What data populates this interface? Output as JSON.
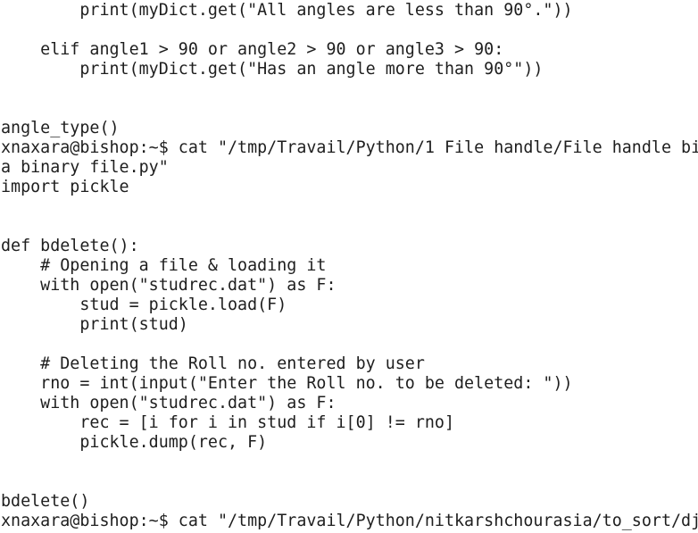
{
  "terminal": {
    "lines": [
      "        print(myDict.get(\"All angles are less than 90°.\"))",
      "",
      "    elif angle1 > 90 or angle2 > 90 or angle3 > 90:",
      "        print(myDict.get(\"Has an angle more than 90°\"))",
      "",
      "",
      "angle_type()",
      "xnaxara@bishop:~$ cat \"/tmp/Travail/Python/1 File handle/File handle bi",
      "a binary file.py\"",
      "import pickle",
      "",
      "",
      "def bdelete():",
      "    # Opening a file & loading it",
      "    with open(\"studrec.dat\") as F:",
      "        stud = pickle.load(F)",
      "        print(stud)",
      "",
      "    # Deleting the Roll no. entered by user",
      "    rno = int(input(\"Enter the Roll no. to be deleted: \"))",
      "    with open(\"studrec.dat\") as F:",
      "        rec = [i for i in stud if i[0] != rno]",
      "        pickle.dump(rec, F)",
      "",
      "",
      "bdelete()",
      "xnaxara@bishop:~$ cat \"/tmp/Travail/Python/nitkarshchourasia/to_sort/dj"
    ]
  },
  "colors": {
    "background": "#ffffff",
    "text": "#1e1e1e"
  }
}
